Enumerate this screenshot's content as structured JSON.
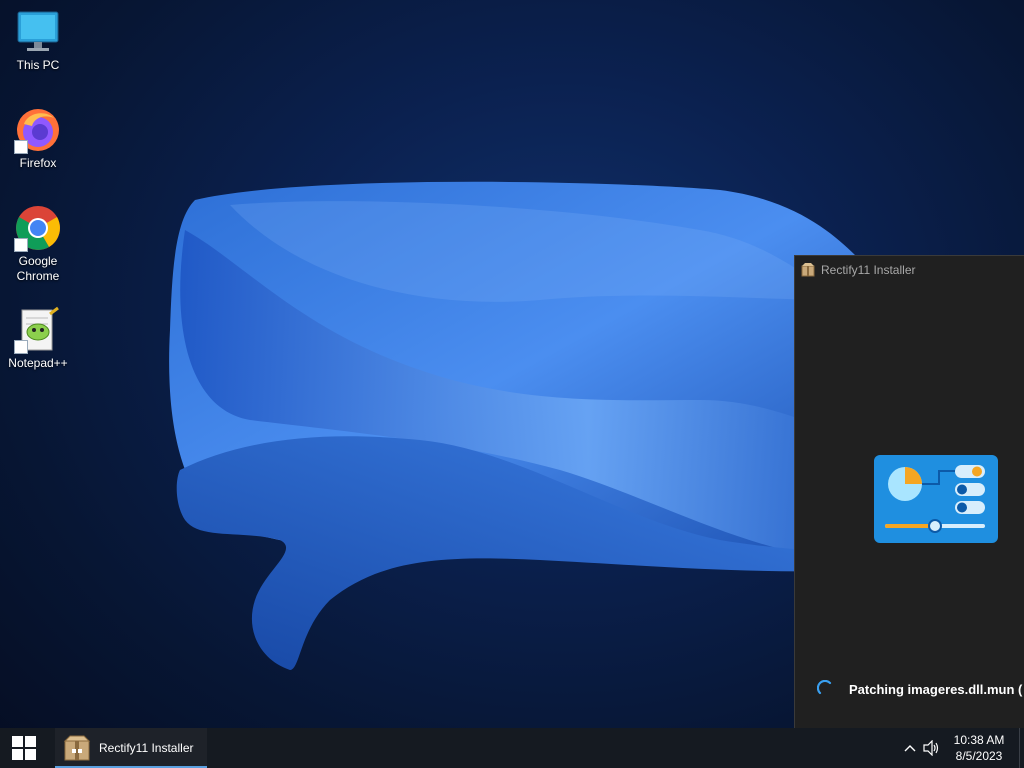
{
  "desktop": {
    "icons": [
      {
        "label": "This PC",
        "icon": "computer-icon"
      },
      {
        "label": "Firefox",
        "icon": "firefox-icon"
      },
      {
        "label": "Google\nChrome",
        "icon": "chrome-icon"
      },
      {
        "label": "Notepad++",
        "icon": "notepadpp-icon"
      }
    ]
  },
  "installer": {
    "title": "Rectify11 Installer",
    "status": "Patching imageres.dll.mun (",
    "colors": {
      "background": "#202020",
      "logo": "#1f8fe0",
      "accent": "#f5a623"
    }
  },
  "taskbar": {
    "app_label": "Rectify11 Installer",
    "clock": {
      "time": "10:38 AM",
      "date": "8/5/2023"
    },
    "accent": "#5aa0e0"
  }
}
